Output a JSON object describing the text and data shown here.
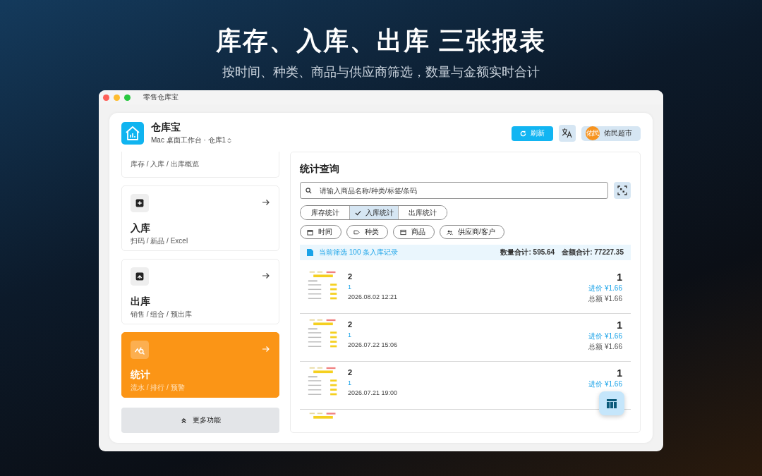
{
  "headline": "库存、入库、出库 三张报表",
  "subheadline": "按时间、种类、商品与供应商筛选，数量与金额实时合计",
  "window": {
    "title": "零售仓库宝"
  },
  "app": {
    "name": "仓库宝",
    "subtitle": "Mac 桌面工作台 · 仓库1"
  },
  "toolbar": {
    "refresh": "刷新",
    "store_badge": "佑民",
    "store": "佑民超市"
  },
  "nav": [
    {
      "kind": "overview",
      "subtitle": "库存 / 入库 / 出库概览",
      "selected": false
    },
    {
      "kind": "inbound",
      "title": "入库",
      "subtitle": "扫码 / 新品 / Excel",
      "selected": false
    },
    {
      "kind": "outbound",
      "title": "出库",
      "subtitle": "销售 / 组合 / 预出库",
      "selected": false
    },
    {
      "kind": "stats",
      "title": "统计",
      "subtitle": "流水 / 排行 / 预警",
      "selected": true
    }
  ],
  "more": "更多功能",
  "panel": {
    "title": "统计查询",
    "search": {
      "placeholder": "请输入商品名称/种类/标签/条码"
    },
    "tabs": [
      {
        "label": "库存统计",
        "selected": false
      },
      {
        "label": "入库统计",
        "selected": true
      },
      {
        "label": "出库统计",
        "selected": false
      }
    ],
    "filters": [
      {
        "kind": "time",
        "label": "时间"
      },
      {
        "kind": "category",
        "label": "种类"
      },
      {
        "kind": "product",
        "label": "商品"
      },
      {
        "kind": "supplier",
        "label": "供应商/客户"
      }
    ],
    "summary": {
      "text": "当前筛选 100 条入库记录",
      "quantity": "数量合计: 595.64",
      "amount": "金额合计: 77227.35"
    },
    "records": [
      {
        "name": "2",
        "category": "1",
        "date": "2026.08.02 12:21",
        "quantity": "1",
        "price": "进价 ¥1.66",
        "total": "总额 ¥1.66"
      },
      {
        "name": "2",
        "category": "1",
        "date": "2026.07.22 15:06",
        "quantity": "1",
        "price": "进价 ¥1.66",
        "total": "总额 ¥1.66"
      },
      {
        "name": "2",
        "category": "1",
        "date": "2026.07.21 19:00",
        "quantity": "1",
        "price": "进价 ¥1.66"
      }
    ]
  }
}
